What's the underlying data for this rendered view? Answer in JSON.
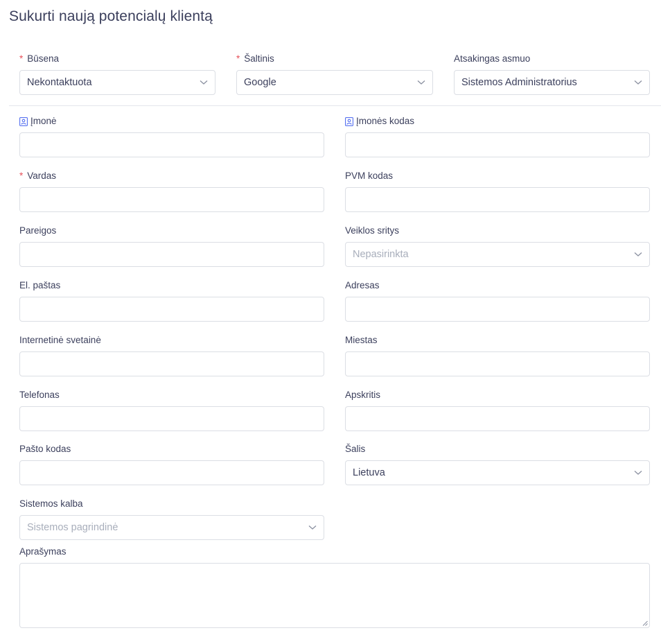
{
  "page": {
    "title": "Sukurti naują potencialų klientą"
  },
  "top_row": {
    "status": {
      "label": "Būsena",
      "required": "*",
      "value": "Nekontaktuota"
    },
    "source": {
      "label": "Šaltinis",
      "required": "*",
      "value": "Google"
    },
    "owner": {
      "label": "Atsakingas asmuo",
      "value": "Sistemos Administratorius"
    }
  },
  "form": {
    "company": {
      "label": "Įmonė",
      "value": ""
    },
    "company_code": {
      "label": "Įmonės kodas",
      "value": ""
    },
    "name": {
      "label": "Vardas",
      "required": "*",
      "value": ""
    },
    "vat_code": {
      "label": "PVM kodas",
      "value": ""
    },
    "position": {
      "label": "Pareigos",
      "value": ""
    },
    "activity": {
      "label": "Veiklos sritys",
      "placeholder": "Nepasirinkta"
    },
    "email": {
      "label": "El. paštas",
      "value": ""
    },
    "address": {
      "label": "Adresas",
      "value": ""
    },
    "website": {
      "label": "Internetinė svetainė",
      "value": ""
    },
    "city": {
      "label": "Miestas",
      "value": ""
    },
    "phone": {
      "label": "Telefonas",
      "value": ""
    },
    "county": {
      "label": "Apskritis",
      "value": ""
    },
    "postal_code": {
      "label": "Pašto kodas",
      "value": ""
    },
    "country": {
      "label": "Šalis",
      "value": "Lietuva"
    },
    "language": {
      "label": "Sistemos kalba",
      "placeholder": "Sistemos pagrindinė"
    },
    "description": {
      "label": "Aprašymas",
      "value": ""
    }
  },
  "colors": {
    "required": "#e7515a",
    "border": "#dbdee4",
    "text": "#3b3f5c",
    "placeholder": "#a8aebb",
    "icon": "#4361ee"
  },
  "icons": {
    "chevron": "chevron-down-icon",
    "contact_card": "contact-card-icon"
  }
}
